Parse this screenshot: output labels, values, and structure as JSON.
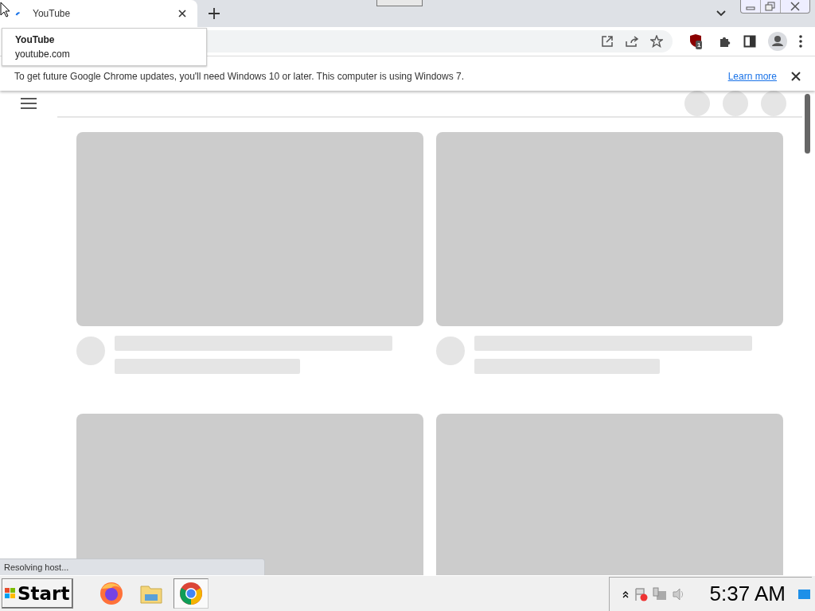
{
  "tabs": [
    {
      "title": "YouTube",
      "selected": true
    }
  ],
  "tab_tooltip": {
    "title": "YouTube",
    "domain": "youtube.com"
  },
  "infobar": {
    "message": "To get future Google Chrome updates, you'll need Windows 10 or later. This computer is using Windows 7.",
    "link": "Learn more"
  },
  "extension_badge": "1",
  "feed": {
    "loading": true
  },
  "status_bubble": "Resolving host...",
  "taskbar": {
    "start": "Start",
    "apps": [
      {
        "kind": "firefox",
        "selected": false
      },
      {
        "kind": "explorer",
        "selected": false
      },
      {
        "kind": "chrome",
        "selected": true
      }
    ],
    "clock": "5:37 AM"
  }
}
